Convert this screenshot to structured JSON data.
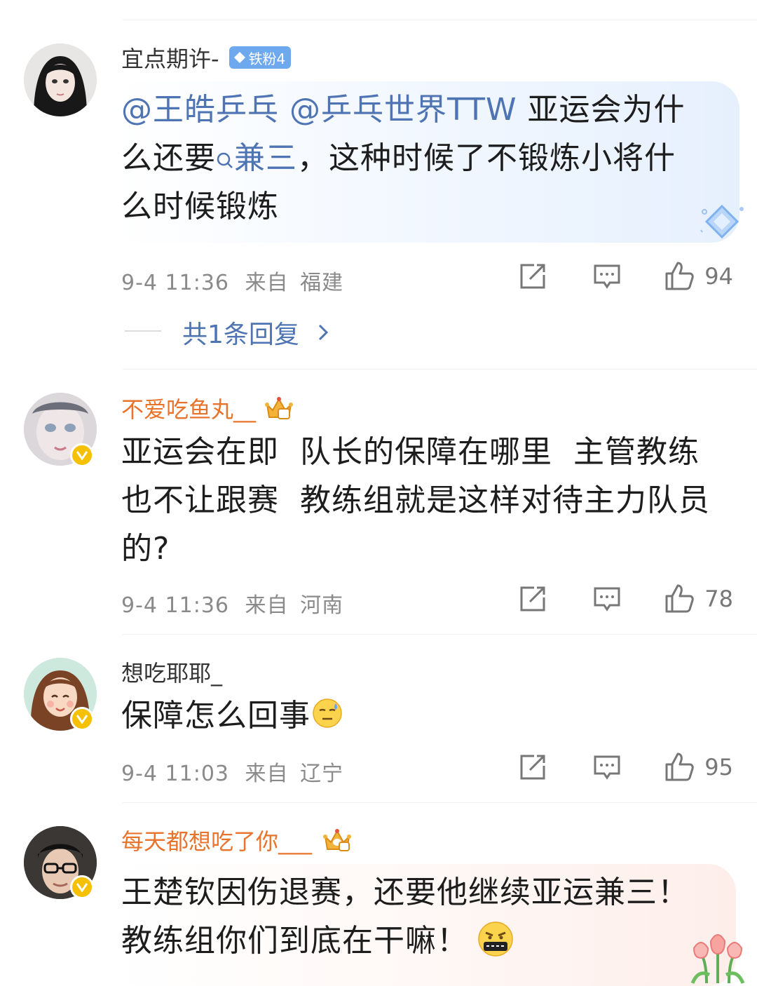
{
  "comments": [
    {
      "username": "宜点期许-",
      "fan_badge": "铁粉4",
      "mentions": [
        "@王皓乒乓",
        "@乒乓世界TTW"
      ],
      "text_line1": "亚运会为什",
      "text_line2_a": "么还要",
      "search_link": "兼三",
      "text_line2_b": "，这种时候了不锻炼小将什",
      "text_line3": "么时候锻炼",
      "time": "9-4 11:36",
      "from_label": "来自",
      "location": "福建",
      "likes": "94",
      "replies_label": "共1条回复"
    },
    {
      "username": "不爱吃鱼丸__",
      "line1": "亚运会在即  队长的保障在哪里  主管教练",
      "line2": "也不让跟赛  教练组就是这样对待主力队员",
      "line3": "的?",
      "time": "9-4 11:36",
      "from_label": "来自",
      "location": "河南",
      "likes": "78"
    },
    {
      "username": "想吃耶耶_",
      "line1": "保障怎么回事",
      "time": "9-4 11:03",
      "from_label": "来自",
      "location": "辽宁",
      "likes": "95"
    },
    {
      "username": "每天都想吃了你___",
      "line1": "王楚钦因伤退赛，还要他继续亚运兼三！",
      "line2": "教练组你们到底在干嘛！"
    }
  ],
  "colors": {
    "link": "#4e74b3",
    "vip_name": "#e8742c",
    "verified_badge": "#f5c000",
    "meta_gray": "#8a8a8a"
  },
  "icons": [
    "share-icon",
    "comment-icon",
    "like-icon",
    "chevron-right-icon",
    "crown-icon",
    "diamond-icon",
    "search-icon",
    "verified-icon"
  ]
}
